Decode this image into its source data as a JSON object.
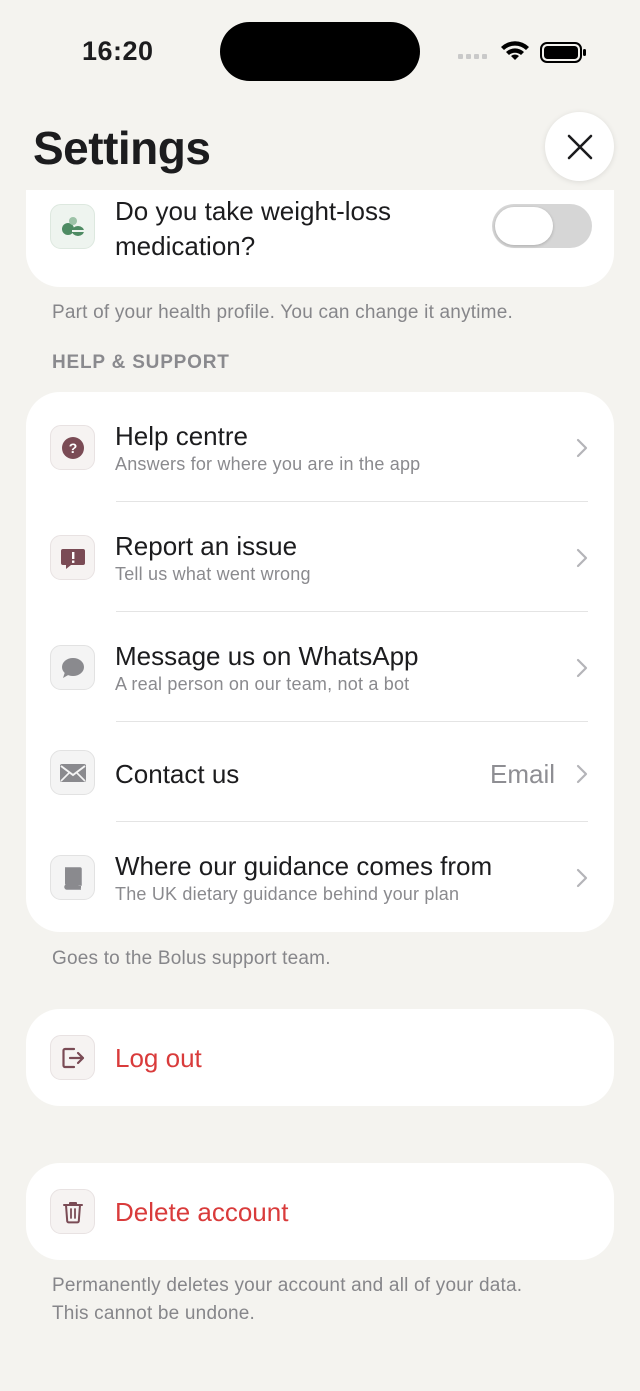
{
  "status_bar": {
    "time": "16:20"
  },
  "header": {
    "title": "Settings"
  },
  "health": {
    "question_line1": "Do you take weight-loss",
    "question_line2": "medication?",
    "toggle_on": false,
    "footnote": "Part of your health profile. You can change it anytime."
  },
  "support": {
    "section_title": "HELP & SUPPORT",
    "items": [
      {
        "title": "Help centre",
        "subtitle": "Answers for where you are in the app",
        "icon": "question-icon"
      },
      {
        "title": "Report an issue",
        "subtitle": "Tell us what went wrong",
        "icon": "report-icon"
      },
      {
        "title": "Message us on WhatsApp",
        "subtitle": "A real person on our team, not a bot",
        "icon": "chat-bubble-icon"
      },
      {
        "title": "Contact us",
        "value": "Email",
        "icon": "mail-icon"
      },
      {
        "title": "Where our guidance comes from",
        "subtitle": "The UK dietary guidance behind your plan",
        "icon": "book-icon"
      }
    ],
    "footnote": "Goes to the Bolus support team."
  },
  "logout": {
    "label": "Log out",
    "icon": "logout-icon"
  },
  "delete_account": {
    "label": "Delete account",
    "icon": "trash-icon",
    "footnote_line1": "Permanently deletes your account and all of your data.",
    "footnote_line2": "This cannot be undone."
  },
  "colors": {
    "background": "#f4f3ef",
    "danger": "#d93b3b",
    "accent_icon": "#7a4b55"
  }
}
